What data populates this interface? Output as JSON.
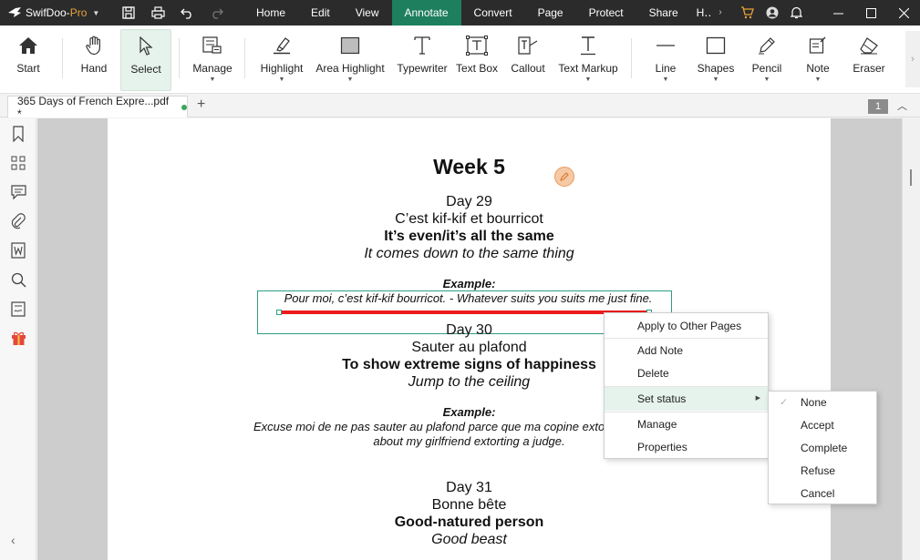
{
  "app": {
    "brand": "SwifDoo-",
    "brand_suffix": "Pro",
    "menu": [
      "Home",
      "Edit",
      "View",
      "Annotate",
      "Convert",
      "Page",
      "Protect",
      "Share",
      "H‥"
    ],
    "active_menu": "Annotate",
    "colors": {
      "titlebar": "#2b2b2b",
      "accent": "#1e7f5f",
      "annotation_line": "#ec1c1c",
      "selection": "#2f9e85"
    }
  },
  "ribbon": {
    "tools": [
      {
        "label": "Start",
        "icon": "home-icon"
      },
      {
        "label": "Hand",
        "icon": "hand-icon"
      },
      {
        "label": "Select",
        "icon": "cursor-icon"
      },
      {
        "label": "Manage",
        "icon": "manage-icon"
      },
      {
        "label": "Highlight",
        "icon": "highlighter-icon"
      },
      {
        "label": "Area Highlight",
        "icon": "area-highlight-icon"
      },
      {
        "label": "Typewriter",
        "icon": "typewriter-icon"
      },
      {
        "label": "Text Box",
        "icon": "textbox-icon"
      },
      {
        "label": "Callout",
        "icon": "callout-icon"
      },
      {
        "label": "Text Markup",
        "icon": "text-markup-icon"
      },
      {
        "label": "Line",
        "icon": "line-icon"
      },
      {
        "label": "Shapes",
        "icon": "shapes-icon"
      },
      {
        "label": "Pencil",
        "icon": "pencil-icon"
      },
      {
        "label": "Note",
        "icon": "note-icon"
      },
      {
        "label": "Eraser",
        "icon": "eraser-icon"
      }
    ]
  },
  "tabs": {
    "doc_title": "365 Days of French Expre...pdf *",
    "page_number": "1"
  },
  "document": {
    "heading": "Week 5",
    "entries": [
      {
        "day": "Day 29",
        "phrase": "C’est kif-kif et bourricot",
        "meaning": "It’s even/it’s all the same",
        "literal": "It comes down to the same thing",
        "example_label": "Example:",
        "example": "Pour moi, c’est kif-kif bourricot. - Whatever suits you suits me just fine."
      },
      {
        "day": "Day 30",
        "phrase": "Sauter au plafond",
        "meaning": "To show extreme signs of happiness",
        "literal": "Jump to the ceiling",
        "example_label": "Example:",
        "example_line1": "Excuse moi de ne pas sauter au plafond parce que ma copine extorque un juge. -",
        "example_line2": "about my girlfriend extorting a judge."
      },
      {
        "day": "Day 31",
        "phrase": "Bonne bête",
        "meaning": "Good-natured person",
        "literal": "Good beast"
      }
    ]
  },
  "context_menu": {
    "items": [
      "Apply to Other Pages",
      "Add Note",
      "Delete",
      "Set status",
      "Manage",
      "Properties"
    ],
    "highlighted": "Set status",
    "submenu": [
      "None",
      "Accept",
      "Complete",
      "Refuse",
      "Cancel"
    ],
    "submenu_checked": "None"
  }
}
